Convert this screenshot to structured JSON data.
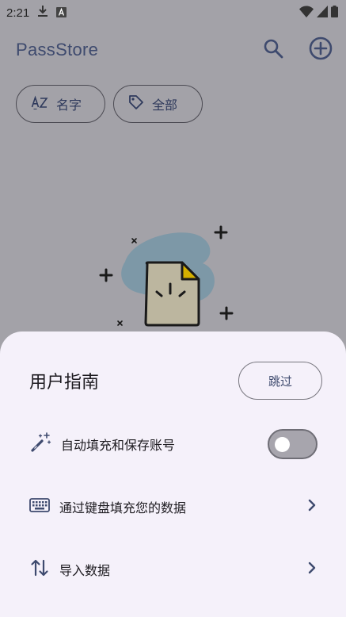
{
  "status_bar": {
    "time": "2:21",
    "icons": [
      "download-icon",
      "text-a-icon",
      "wifi-icon",
      "signal-icon",
      "battery-icon"
    ]
  },
  "app_bar": {
    "title": "PassStore",
    "actions": [
      "search-icon",
      "add-circle-icon"
    ]
  },
  "filters": {
    "sort_label": "名字",
    "tag_label": "全部"
  },
  "sheet": {
    "title": "用户指南",
    "skip_label": "跳过",
    "items": [
      {
        "icon": "magic-wand-icon",
        "label": "自动填充和保存账号",
        "control": "switch",
        "enabled": false
      },
      {
        "icon": "keyboard-icon",
        "label": "通过键盘填充您的数据",
        "control": "chevron"
      },
      {
        "icon": "import-export-icon",
        "label": "导入数据",
        "control": "chevron"
      }
    ]
  },
  "colors": {
    "scrim_background": "#a3a2a8",
    "sheet_background": "#f5f1fa",
    "brand_text": "#3e4a6e",
    "illustration_blob": "#5f8fa6",
    "document_fill": "#bcb69f",
    "document_fold": "#d4b000"
  }
}
